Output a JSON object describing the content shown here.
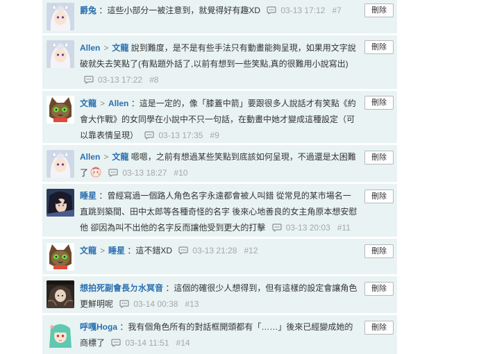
{
  "delete_label": "刪除",
  "reply_icon": "speech-bubble-icon",
  "colors": {
    "author": "#2a6fb0",
    "meta": "#a6a6a6",
    "panel_bg": "#e9f3f3"
  },
  "comments": [
    {
      "author": "爵兔",
      "reply_to": "",
      "text": "：這些小部分一被注意到，就覺得好有趣XD",
      "time": "03-13 17:12",
      "num": "#7",
      "avatar": "white-hair-girl"
    },
    {
      "author": "Allen",
      "reply_to": "文龍",
      "text": "說到難度，是不是有些手法只有動畫能夠呈現，如果用文字說破就失去笑點了(有點題外話了,以前有想到一些笑點,真的很難用小說寫出)",
      "time": "03-13 17:22",
      "num": "#8",
      "avatar": "white-hair-girl"
    },
    {
      "author": "文龍",
      "reply_to": "Allen",
      "text": "：這是一定的，像「膝蓋中箭」要跟很多人說話才有笑點《約會大作戰》的女同學在小說中不只一句話，在動畫中她才變成這種設定（可以靠表情呈現）",
      "time": "03-13 17:35",
      "num": "#9",
      "avatar": "green-cat"
    },
    {
      "author": "Allen",
      "reply_to": "文龍",
      "text": "嗯嗯，之前有想過某些笑點到底該如何呈現，不過還是太困難了",
      "time": "03-13 18:27",
      "num": "#10",
      "avatar": "white-hair-girl"
    },
    {
      "author": "睡星",
      "reply_to": "",
      "text": "：曾經寫過一個路人角色名字永遠都會被人叫錯 從常見的某市場名一直跳到築間、田中太郎等各種奇怪的名字 後來心地善良的女主角原本想安慰他 卻因為叫不出他的名字反而讓他受到更大的打擊",
      "time": "03-13 20:03",
      "num": "#11",
      "avatar": "dark-hair-boy"
    },
    {
      "author": "文龍",
      "reply_to": "睡星",
      "text": "：這不錯XD",
      "time": "03-13 21:28",
      "num": "#12",
      "avatar": "green-cat"
    },
    {
      "author": "想拍死副會長ㄉ水冥音",
      "reply_to": "",
      "text": "：這個的確很少人想得到，但有這樣的設定會讓角色更鮮明呢",
      "time": "03-14 00:38",
      "num": "#13",
      "avatar": "dark-scene"
    },
    {
      "author": "呼嘎Hoga",
      "reply_to": "",
      "text": "：我有個角色所有的對話框開頭都有「……」後來已經變成她的商標了",
      "time": "03-14 11:51",
      "num": "#14",
      "avatar": "teal-hair-girl"
    }
  ]
}
